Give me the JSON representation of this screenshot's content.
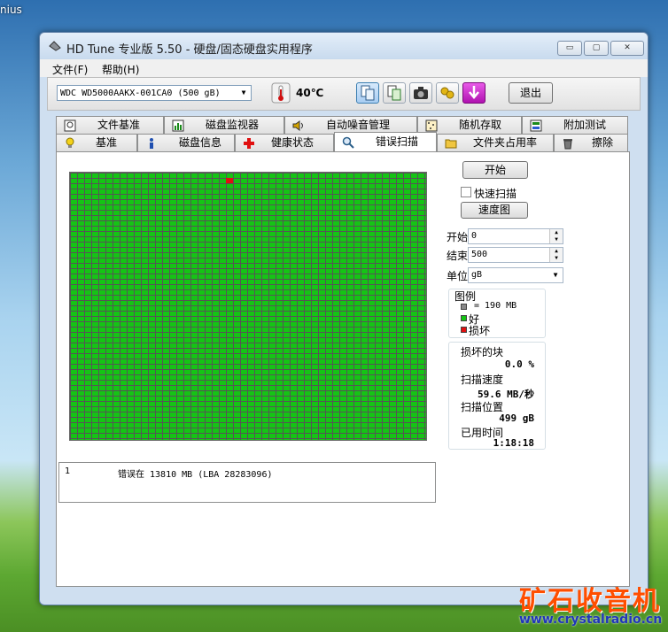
{
  "desktop": {
    "corner_label": "nius"
  },
  "window": {
    "title": "HD Tune 专业版 5.50 - 硬盘/固态硬盘实用程序",
    "controls": {
      "minimize": "▭",
      "maximize": "▢",
      "close": "✕"
    }
  },
  "menu": {
    "items": [
      "文件(F)",
      "帮助(H)"
    ]
  },
  "toolbar": {
    "drive": "WDC WD5000AAKX-001CA0 (500 gB)",
    "temperature": "40℃",
    "exit_label": "退出"
  },
  "tabs": {
    "row1": [
      "文件基准",
      "磁盘监视器",
      "自动噪音管理",
      "随机存取",
      "附加测试"
    ],
    "row2": [
      "基准",
      "磁盘信息",
      "健康状态",
      "错误扫描",
      "文件夹占用率",
      "擦除"
    ],
    "selected": "错误扫描"
  },
  "error_scan": {
    "start_button": "开始",
    "quick_scan_label": "快速扫描",
    "quick_scan_checked": false,
    "speed_map_button": "速度图",
    "start_label": "开始",
    "start_value": "0",
    "end_label": "结束",
    "end_value": "500",
    "unit_label": "单位",
    "unit_value": "gB",
    "legend": {
      "title": "图例",
      "block_size": "= 190 MB",
      "good": "好",
      "bad": "损坏"
    },
    "stats": {
      "damaged_label": "损坏的块",
      "damaged_value": "0.0 %",
      "speed_label": "扫描速度",
      "speed_value": "59.6 MB/秒",
      "position_label": "扫描位置",
      "position_value": "499 gB",
      "elapsed_label": "已用时间",
      "elapsed_value": "1:18:18"
    },
    "log": [
      {
        "index": "1",
        "message": "错误在 13810 MB (LBA 28283096)"
      }
    ]
  },
  "colors": {
    "good": "#15c415",
    "bad": "#e01010",
    "gridline": "#555555"
  },
  "watermark": {
    "text": "矿石收音机",
    "url": "www.crystalradio.cn"
  }
}
